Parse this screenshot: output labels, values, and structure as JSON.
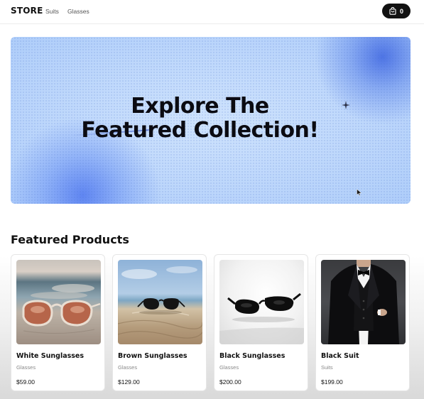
{
  "header": {
    "logo": "STORE",
    "nav": [
      {
        "label": "Suits"
      },
      {
        "label": "Glasses"
      }
    ],
    "cart": {
      "count": "0",
      "icon": "shopping-bag-icon"
    }
  },
  "hero": {
    "title_line1": "Explore The",
    "title_line2": "Featured Collection!",
    "icons": [
      "sparkle-icon",
      "cursor-icon"
    ]
  },
  "featured": {
    "title": "Featured Products",
    "products": [
      {
        "name": "White Sunglasses",
        "category": "Glasses",
        "price": "$59.00"
      },
      {
        "name": "Brown Sunglasses",
        "category": "Glasses",
        "price": "$129.00"
      },
      {
        "name": "Black Sunglasses",
        "category": "Glasses",
        "price": "$200.00"
      },
      {
        "name": "Black Suit",
        "category": "Suits",
        "price": "$199.00"
      }
    ]
  },
  "colors": {
    "header_bg": "#ffffff",
    "cart_bg": "#111111",
    "hero_bg": "#bcd6fb",
    "hero_accent": "#4f78ec",
    "text": "#111111",
    "muted_text": "#888888"
  }
}
